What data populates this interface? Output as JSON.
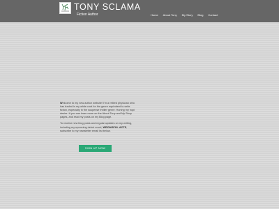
{
  "header": {
    "title": "TONY SCLAMA",
    "tagline": "Fiction Author",
    "logo_icon": "tree-sketch-icon"
  },
  "nav": {
    "items": [
      {
        "label": "Home"
      },
      {
        "label": "About Tony"
      },
      {
        "label": "My Story"
      },
      {
        "label": "Blog"
      },
      {
        "label": "Contact"
      }
    ]
  },
  "main": {
    "intro": {
      "lead": "W",
      "line1": "elcome to my new author website! I'm a retired",
      "line2": "physician who has traded in my white coat for",
      "line3": "the genre equivalent to write fiction, especially in the",
      "line4": "suspense thriller genre. Honing my hopi desire.",
      "line5": "If you can learn more on the About Tony and My Story pages,",
      "line6": "and read my posts on my Blog page."
    },
    "signup_text": {
      "line1": "To receive new blog posts and regular updates on my",
      "line2": "writing, including my upcoming debut novel,",
      "title_bold": "WRONGFUL",
      "line3_bold": "ACTS",
      "line3_rest": ", subscribe to my newsletter email list below."
    },
    "signup_button": "SIGN UP NOW"
  },
  "colors": {
    "header_bg": "#666666",
    "page_bg": "#d4d4d4",
    "button_bg": "#2aa876"
  }
}
